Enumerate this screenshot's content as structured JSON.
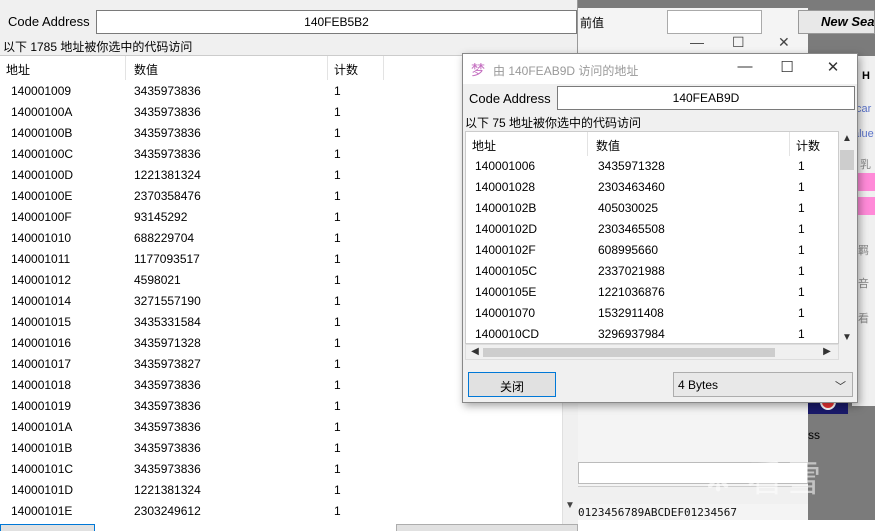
{
  "main_window": {
    "code_address_label": "Code Address",
    "code_address_value": "140FEB5B2",
    "summary": "以下 1785 地址被你选中的代码访问",
    "columns": [
      "地址",
      "数值",
      "计数"
    ],
    "rows": [
      [
        "140001009",
        "3435973836",
        "1"
      ],
      [
        "14000100A",
        "3435973836",
        "1"
      ],
      [
        "14000100B",
        "3435973836",
        "1"
      ],
      [
        "14000100C",
        "3435973836",
        "1"
      ],
      [
        "14000100D",
        "1221381324",
        "1"
      ],
      [
        "14000100E",
        "2370358476",
        "1"
      ],
      [
        "14000100F",
        "93145292",
        "1"
      ],
      [
        "140001010",
        "688229704",
        "1"
      ],
      [
        "140001011",
        "1177093517",
        "1"
      ],
      [
        "140001012",
        "4598021",
        "1"
      ],
      [
        "140001014",
        "3271557190",
        "1"
      ],
      [
        "140001015",
        "3435331584",
        "1"
      ],
      [
        "140001016",
        "3435971328",
        "1"
      ],
      [
        "140001017",
        "3435973827",
        "1"
      ],
      [
        "140001018",
        "3435973836",
        "1"
      ],
      [
        "140001019",
        "3435973836",
        "1"
      ],
      [
        "14000101A",
        "3435973836",
        "1"
      ],
      [
        "14000101B",
        "3435973836",
        "1"
      ],
      [
        "14000101C",
        "3435973836",
        "1"
      ],
      [
        "14000101D",
        "1221381324",
        "1"
      ],
      [
        "14000101E",
        "2303249612",
        "1"
      ]
    ]
  },
  "dialog": {
    "title": "由 140FEAB9D 访问的地址",
    "code_address_label": "Code Address",
    "code_address_value": "140FEAB9D",
    "summary": "以下 75 地址被你选中的代码访问",
    "columns": [
      "地址",
      "数值",
      "计数"
    ],
    "rows": [
      [
        "140001006",
        "3435971328",
        "1"
      ],
      [
        "140001028",
        "2303463460",
        "1"
      ],
      [
        "14000102B",
        "405030025",
        "1"
      ],
      [
        "14000102D",
        "2303465508",
        "1"
      ],
      [
        "14000102F",
        "608995660",
        "1"
      ],
      [
        "14000105C",
        "2337021988",
        "1"
      ],
      [
        "14000105E",
        "1221036876",
        "1"
      ],
      [
        "140001070",
        "1532911408",
        "1"
      ],
      [
        "1400010CD",
        "3296937984",
        "1"
      ]
    ],
    "close_button": "关闭",
    "size_select": "4 Bytes",
    "title_controls": [
      "—",
      "☐",
      "✕"
    ]
  },
  "background": {
    "value_label": "前值",
    "new_search": "New Sea",
    "side_fragments": [
      "H",
      "car",
      "alue",
      "乳",
      "羁",
      "咅",
      "看"
    ],
    "hex_header": "0123456789ABCDEF01234567",
    "s_fragment": "ss",
    "watermark": "❋ 看雪",
    "behind_controls": [
      "—",
      "☐",
      "✕"
    ]
  },
  "colors": {
    "focus_blue": "#0078d7",
    "pink_highlight": "#ff8ad8",
    "list_bg": "#ffffff",
    "window_bg": "#f0f0f0"
  }
}
